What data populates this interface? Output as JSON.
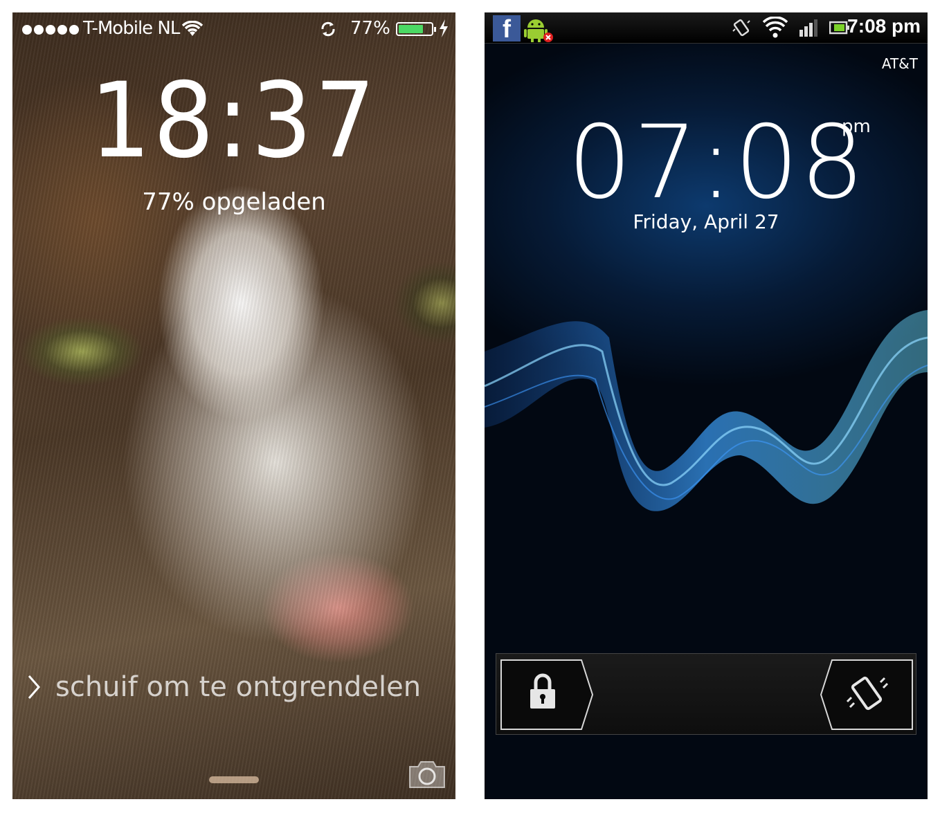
{
  "ios": {
    "carrier": "T-Mobile NL",
    "battery_percent": "77%",
    "battery_level": 0.77,
    "battery_color": "#4cd964",
    "clock": "18:37",
    "charge_status": "77% opgeladen",
    "slide_label": "schuif om te ontgrendelen",
    "icons": [
      "signal-dots-icon",
      "wifi-icon",
      "rotation-lock-icon",
      "battery-icon",
      "charging-bolt-icon",
      "chevron-right-icon",
      "camera-icon"
    ]
  },
  "android": {
    "status_time": "7:08 pm",
    "carrier": "AT&T",
    "clock": "07:08",
    "ampm": "pm",
    "date": "Friday, April 27",
    "fb_glyph": "f",
    "accent": "#2f8fff",
    "icons": [
      "facebook-icon",
      "android-debug-icon",
      "vibrate-icon",
      "wifi-icon",
      "signal-icon",
      "battery-icon",
      "lock-icon",
      "vibrate-toggle-icon"
    ]
  }
}
